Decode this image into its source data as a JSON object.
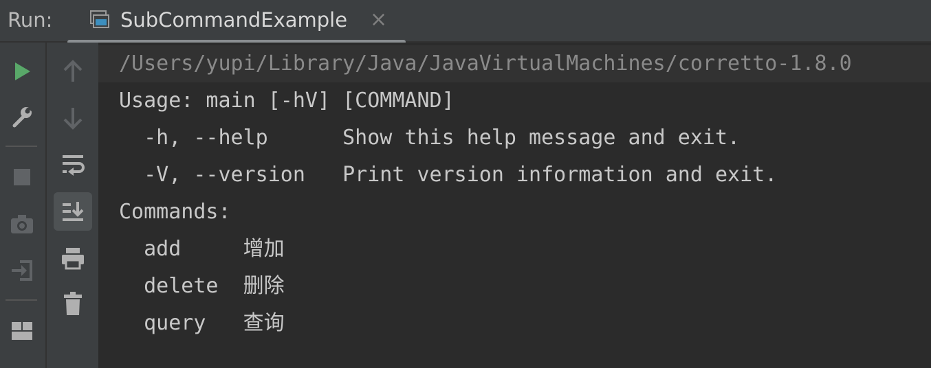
{
  "header": {
    "run_label": "Run:",
    "tab_title": "SubCommandExample",
    "tab_close": "×"
  },
  "toolbar_left": [
    {
      "name": "rerun-button",
      "icon": "play-icon",
      "color": "#59a869"
    },
    {
      "name": "settings-button",
      "icon": "wrench-icon"
    },
    {
      "name": "stop-button",
      "icon": "stop-icon"
    },
    {
      "name": "dump-threads-button",
      "icon": "camera-icon"
    },
    {
      "name": "exit-button",
      "icon": "exit-icon"
    },
    {
      "name": "layout-button",
      "icon": "layout-icon"
    }
  ],
  "toolbar_right": [
    {
      "name": "up-button",
      "icon": "arrow-up-icon"
    },
    {
      "name": "down-button",
      "icon": "arrow-down-icon"
    },
    {
      "name": "soft-wrap-button",
      "icon": "soft-wrap-icon"
    },
    {
      "name": "scroll-to-end-button",
      "icon": "scroll-to-end-icon",
      "active": true
    },
    {
      "name": "print-button",
      "icon": "printer-icon"
    },
    {
      "name": "clear-button",
      "icon": "trash-icon"
    }
  ],
  "console": {
    "command_line": "/Users/yupi/Library/Java/JavaVirtualMachines/corretto-1.8.0",
    "lines": [
      "Usage: main [-hV] [COMMAND]",
      "  -h, --help      Show this help message and exit.",
      "  -V, --version   Print version information and exit.",
      "Commands:",
      "  add     增加",
      "  delete  删除",
      "  query   查询"
    ]
  },
  "colors": {
    "panel_bg": "#3c3f41",
    "console_bg": "#2b2b2b",
    "text": "#c8c8c8",
    "command_line_text": "#8a8a8a",
    "run_icon": "#59a869"
  }
}
